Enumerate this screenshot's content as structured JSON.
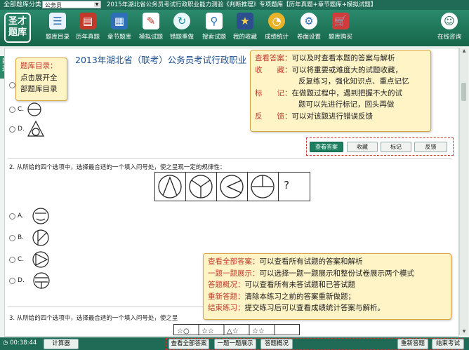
{
  "topbar": {
    "category_label": "全部题库分类:",
    "category_value": "公务员",
    "title": "2015年湖北省公务员考试行政职业能力测验《判断推理》专项题库【历年真题+章节题库+模拟试题】"
  },
  "logo": {
    "text": "圣才题库"
  },
  "toolbar": {
    "items": [
      {
        "label": "题库目录",
        "icon": "catalog-icon"
      },
      {
        "label": "历年真题",
        "icon": "past-exam-icon"
      },
      {
        "label": "章节题库",
        "icon": "chapter-bank-icon"
      },
      {
        "label": "模拟试题",
        "icon": "mock-exam-icon"
      },
      {
        "label": "错题重做",
        "icon": "redo-wrong-icon"
      },
      {
        "label": "搜索试题",
        "icon": "search-icon"
      },
      {
        "label": "我的收藏",
        "icon": "favorites-icon"
      },
      {
        "label": "成绩统计",
        "icon": "stats-icon"
      },
      {
        "label": "卷面设置",
        "icon": "settings-icon"
      },
      {
        "label": "题库购买",
        "icon": "cart-icon"
      }
    ],
    "online": {
      "label": "在线咨询",
      "icon": "chat-icon"
    }
  },
  "left_tab": "目录",
  "exam_title": "2013年湖北省（联考）公务员考试行政职业",
  "q1": {
    "options": [
      "C.",
      "D."
    ],
    "buttons": [
      "查看答案",
      "收藏",
      "标记",
      "反馈"
    ]
  },
  "q2": {
    "text": "2. 从所给的四个选项中，选择最合适的一个填入问号处，使之呈现一定的规律性：",
    "question_mark": "?",
    "options": [
      "A.",
      "B.",
      "C.",
      "D."
    ]
  },
  "q3": {
    "text": "3. 从所给的四个选项中，选择最合适的一个填入问号处，使之呈"
  },
  "tips": {
    "catalog": {
      "line1": "题库目录：",
      "line2": "点击展开全",
      "line3": "部题库目录"
    },
    "answer": [
      {
        "key": "查看答案：",
        "text": "可以及时查看本题的答案与解析"
      },
      {
        "key": "收　　藏：",
        "text": "可以将重要或难度大的试题收藏，"
      },
      {
        "key": "",
        "text": "反复练习，强化知识点、重点记忆"
      },
      {
        "key": "标　　记：",
        "text": "在做题过程中，遇到把握不大的试"
      },
      {
        "key": "",
        "text": "题可以先进行标记，回头再做"
      },
      {
        "key": "反　　馈：",
        "text": "可以对该题进行错误反馈"
      }
    ],
    "bottom": [
      {
        "key": "查看全部答案：",
        "text": "可以查看所有试题的答案和解析"
      },
      {
        "key": "一题一题展示：",
        "text": "可以选择一题一题展示和整份试卷展示两个模式"
      },
      {
        "key": "答题概况：",
        "text": "可以查看所有未答试题和已答试题"
      },
      {
        "key": "重新答题：",
        "text": "清除本练习之前的答案重新做题；"
      },
      {
        "key": "结束练习：",
        "text": "提交练习后可以查看成绩统计答案与解析。"
      }
    ]
  },
  "bottombar": {
    "timer": "00:38:44",
    "calculator": "计算器",
    "show_all": "查看全部答案",
    "one_by_one": "一题一题展示",
    "overview": "答题概况",
    "restart": "重新答题",
    "finish": "结束考试"
  }
}
